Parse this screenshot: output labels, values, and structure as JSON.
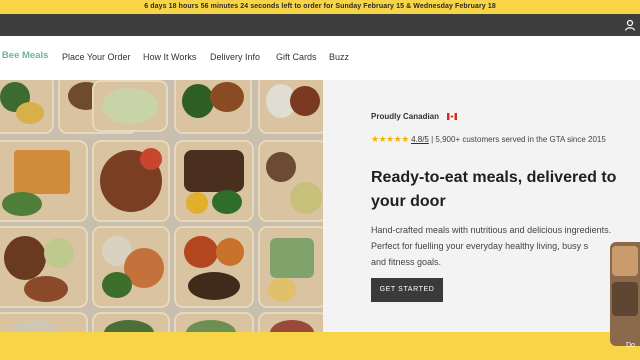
{
  "announcement": "6 days 18 hours 56 minutes 24 seconds left to order for Sunday February 15 & Wednesday February 18",
  "logo": "y Bee Meals",
  "nav": {
    "items": [
      "Place Your Order",
      "How It Works",
      "Delivery Info",
      "Gift Cards",
      "Buzz"
    ]
  },
  "hero": {
    "proudly": "Proudly Canadian",
    "stars": "★★★★★",
    "score": "4.8/5",
    "separator": "|",
    "customers": "5,900+ customers served in the GTA since 2015",
    "headline_line1": "Ready-to-eat meals, delivered to",
    "headline_line2": "your door",
    "desc_line1": "Hand-crafted meals with nutritious and delicious ingredients.",
    "desc_line2": "Perfect for fuelling your everyday healthy living, busy s",
    "desc_line3": "and fitness goals.",
    "cta": "GET STARTED"
  },
  "side_widget_label": "Do",
  "colors": {
    "announcement_bg": "#f7d547",
    "utility_bar": "#3e3e3e",
    "logo": "#6fb59a",
    "hero_right_bg": "#f3f3f3",
    "cta_bg": "#3a3a3a",
    "stars": "#f5b300"
  },
  "icons": {
    "account": "user-icon",
    "flag": "canada-flag-icon"
  }
}
